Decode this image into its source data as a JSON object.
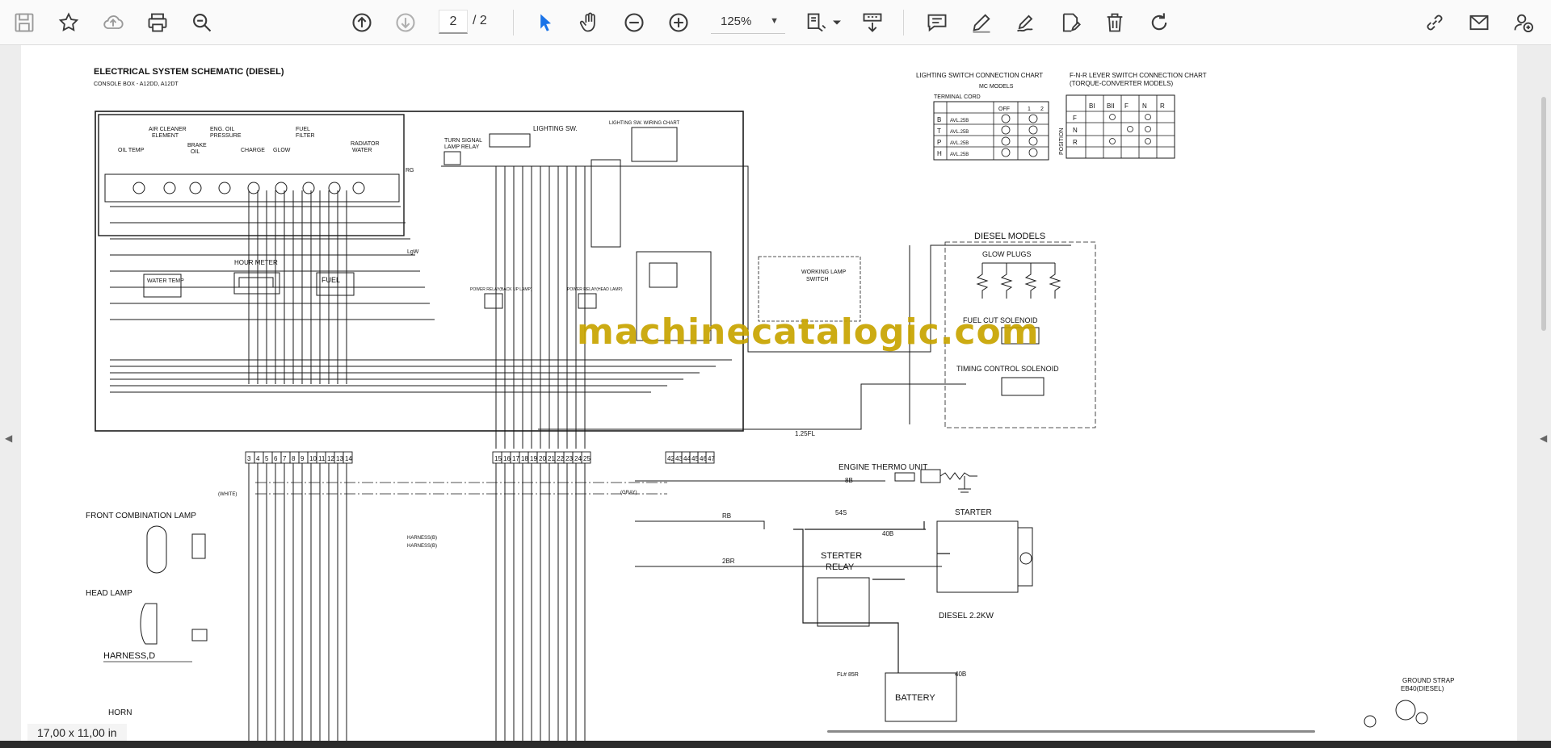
{
  "toolbar": {
    "page_current": "2",
    "page_total": "/ 2",
    "zoom": "125%",
    "colors": {
      "icon": "#3a3a3a",
      "select_accent": "#1a73e8"
    },
    "icons": [
      "save-icon",
      "star-icon",
      "cloud-upload-icon",
      "print-icon",
      "zoom-search-icon",
      "page-up-icon",
      "page-down-icon",
      "select-cursor-icon",
      "hand-icon",
      "zoom-out-icon",
      "zoom-in-icon",
      "fit-page-icon",
      "download-icon",
      "comment-icon",
      "pen-icon",
      "sign-icon",
      "edit-page-icon",
      "delete-icon",
      "rotate-icon",
      "share-link-icon",
      "mail-icon",
      "add-user-icon"
    ]
  },
  "document": {
    "size_label": "17,00 x 11,00 in",
    "watermark": "machinecatalogic.com",
    "title": "ELECTRICAL SYSTEM SCHEMATIC (DIESEL)",
    "subtitle": "CONSOLE BOX - A12DD, A12DT",
    "labels": {
      "air_cleaner": "AIR CLEANER",
      "element": "ELEMENT",
      "eng_oil": "ENG. OIL",
      "pressure": "PRESSURE",
      "fuel": "FUEL",
      "filter": "FILTER",
      "oil_temp": "OIL TEMP",
      "brake": "BRAKE",
      "oil": "OIL",
      "charge": "CHARGE",
      "glow": "GLOW",
      "radiator": "RADIATOR",
      "water": "WATER",
      "turn_signal": "TURN SIGNAL",
      "lamp_relay": "LAMP RELAY",
      "lighting_sw": "LIGHTING SW.",
      "lighting_sw_chart": "LIGHTING SW. WIRING CHART",
      "water_temp": "WATER TEMP",
      "hour_meter": "HOUR METER",
      "fuel_gauge": "FUEL",
      "power_relay_back": "POWER RELAY(BACK UP LAMP)",
      "power_relay_head": "POWER RELAY(HEAD LAMP)",
      "working_lamp": "WORKING LAMP",
      "switch": "SWITCH",
      "diesel_models": "DIESEL MODELS",
      "glow_plugs": "GLOW PLUGS",
      "fuel_cut": "FUEL CUT SOLENOID",
      "timing_control": "TIMING CONTROL SOLENOID",
      "engine_thermo": "ENGINE THERMO UNIT",
      "starter": "STARTER",
      "sterter": "STERTER",
      "relay": "RELAY",
      "diesel_kw": "DIESEL   2.2KW",
      "battery": "BATTERY",
      "front_combination": "FRONT COMBINATION LAMP",
      "head_lamp": "HEAD LAMP",
      "harness_d": "HARNESS,D",
      "horn": "HORN",
      "ground_strap": "GROUND STRAP",
      "eb40": "EB40(DIESEL)",
      "harness_b1": "HARNESS(B)",
      "harness_b2": "HARNESS(B)",
      "white": "(WHITE)",
      "gray": "(GRAY)",
      "w_rg": "RG",
      "w_lgw": "LgW",
      "w_125fl": "1.25FL",
      "w_8b": "8B",
      "w_3rb": "RB",
      "w_545": "54S",
      "w_40b": "40B",
      "w_2br": "2BR",
      "w_fl85r": "FL# 85R",
      "w_m40b": "40B",
      "lsc_title": "LIGHTING SWITCH CONNECTION CHART",
      "lsc_sub": "MC MODELS",
      "lsc_terminal": "TERMINAL CORD",
      "fnr_title": "F-N-R LEVER SWITCH CONNECTION CHART",
      "fnr_sub": "(TORQUE-CONVERTER MODELS)",
      "position": "POSITION"
    },
    "lsc_head": [
      "OFF",
      "1",
      "2"
    ],
    "lsc_rows": [
      {
        "t": "B",
        "c": "AVL.25B"
      },
      {
        "t": "T",
        "c": "AVL.25B"
      },
      {
        "t": "P",
        "c": "AVL.25B"
      },
      {
        "t": "H",
        "c": "AVL.25B"
      }
    ],
    "fnr_head": [
      "BI",
      "BII",
      "F",
      "N",
      "R"
    ],
    "fnr_rows": [
      "F",
      "N",
      "R"
    ],
    "connector_left": [
      "3",
      "4",
      "5",
      "6",
      "7",
      "8",
      "9",
      "10",
      "11",
      "12",
      "13",
      "14"
    ],
    "connector_mid": [
      "15",
      "16",
      "17",
      "18",
      "19",
      "20",
      "21",
      "22",
      "23",
      "24",
      "25"
    ],
    "connector_right": [
      "42",
      "43",
      "44",
      "45",
      "46",
      "47"
    ]
  }
}
